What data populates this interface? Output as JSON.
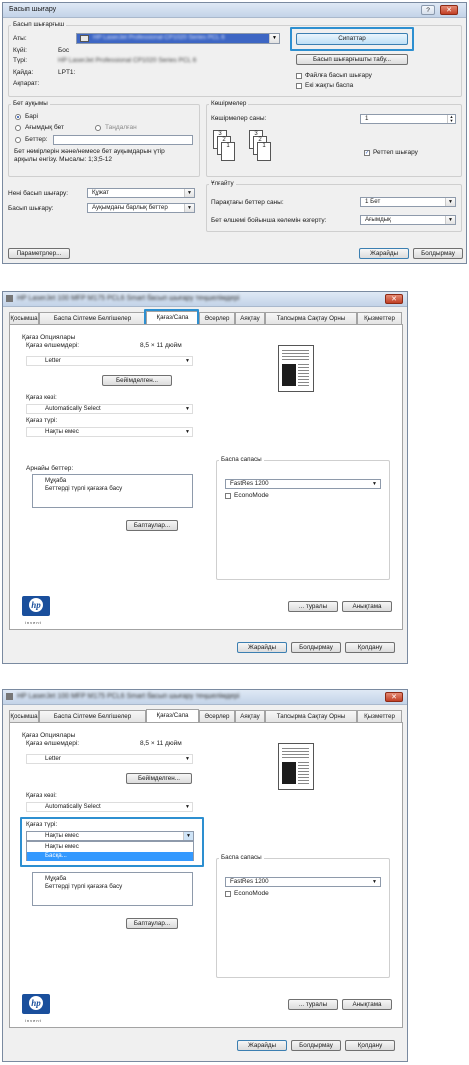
{
  "win1": {
    "title": "Басып шығару",
    "printer_group_label": "Басып шығарғыш",
    "name_label": "Аты:",
    "name_value": "HP LaserJet Professional CP1020 Series PCL 6",
    "status_label": "Күйі:",
    "status_value": "Бос",
    "type_label": "Түрі:",
    "type_value": "HP LaserJet Professional CP1020 Series PCL 6",
    "where_label": "Қайда:",
    "where_value": "LPT1:",
    "comment_label": "Ақпарат:",
    "properties_button": "Сипаттар",
    "find_printer_button": "Басып шығарғышты табу...",
    "print_to_file_label": "Файлға басып шығару",
    "manual_duplex_label": "Екі жақты баспа",
    "page_range_label": "Бет ауқымы",
    "all_label": "Барі",
    "current_page_label": "Ағымдық бет",
    "selection_label": "Таңдалған",
    "pages_label": "Беттер:",
    "pages_hint_line1": "Бет нөмірлерін және/немесе бет ауқымдарын үтір",
    "pages_hint_line2": "арқылы енгізу. Мысалы: 1;3;5-12",
    "copies_group_label": "Көшірмелер",
    "copies_count_label": "Көшірмелер саны:",
    "copies_value": "1",
    "collate_label": "Реттеп шығару",
    "print_what_label": "Нені басып шығару:",
    "print_what_value": "Құжат",
    "print_label": "Басып шығару:",
    "print_value": "Ауқымдағы барлық беттер",
    "zoom_group_label": "Ұлғайту",
    "pages_per_sheet_label": "Парақтағы беттер саны:",
    "pages_per_sheet_value": "1 Бет",
    "scale_label": "Бет өлшемі бойынша көлемін өзгерту:",
    "scale_value": "Ағымдық",
    "options_button": "Параметрлер...",
    "ok_button": "Жарайды",
    "cancel_button": "Болдырмау"
  },
  "win2": {
    "title": "HP LaserJet 100 MFP M175 PCL6 Smart басып шығару теңшелімдері",
    "tabs": [
      "Қосымша",
      "Баспа Сілтеме Белгішелер",
      "Қағаз/Сапа",
      "Әсерлер",
      "Аяқтау",
      "Тапсырма Сақтау Орны",
      "Қызметтер"
    ],
    "paper_options_label": "Қағаз Опциялары",
    "paper_size_label": "Қағаз өлшемдері:",
    "paper_size_value": "8,5 × 11 дюйм",
    "paper_size_select": "Letter",
    "custom_button": "Бейімделген...",
    "paper_source_label": "Қағаз көзі:",
    "paper_source_value": "Automatically Select",
    "paper_type_label": "Қағаз түрі:",
    "paper_type_value": "Нақты емес",
    "special_pages_label": "Арнайы беттер:",
    "special_pages_items": [
      "Мұқаба",
      "Беттерді түрлі қағазға басу"
    ],
    "settings_button": "Баптаулар...",
    "print_quality_label": "Баспа сапасы",
    "print_quality_value": "FastRes 1200",
    "economode_label": "EconoMode",
    "about_button": "... туралы",
    "help_button": "Анықтама",
    "ok_button": "Жарайды",
    "cancel_button": "Болдырмау",
    "apply_button": "Қолдану",
    "hp_invent": "invent"
  },
  "win3": {
    "title": "HP LaserJet 100 MFP M175 PCL6 Smart басып шығару теңшелімдері",
    "paper_type_dropdown_options": [
      "Нақты емес",
      "Басқа..."
    ],
    "paper_type_highlighted": "Басқа..."
  }
}
